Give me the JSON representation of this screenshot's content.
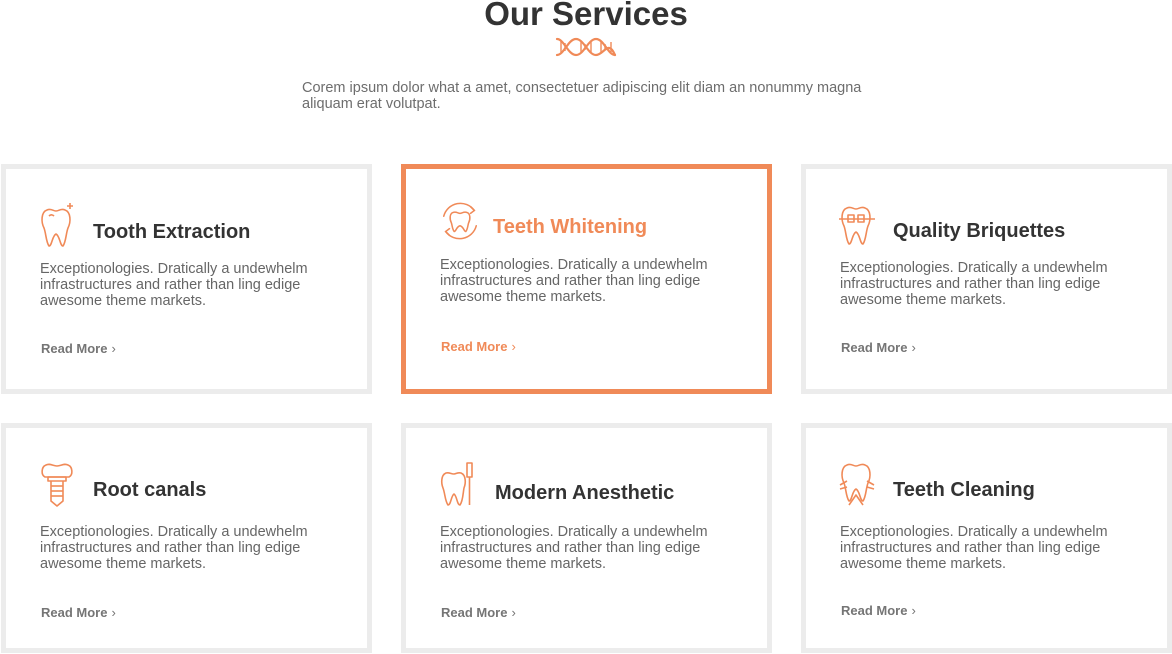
{
  "header": {
    "title": "Our Services",
    "intro": "Corem ipsum dolor what a amet, consectetuer adipiscing elit diam an nonummy magna aliquam erat volutpat."
  },
  "colors": {
    "accent": "#f08a58",
    "border": "#ececec",
    "title": "#333333",
    "text": "#666666"
  },
  "services": [
    {
      "title": "Tooth Extraction",
      "icon": "tooth-sparkle-icon",
      "description": "Exceptionologies. Dratically a undewhelm infrastructures and rather than ling edige awesome theme markets.",
      "link": "Read More",
      "link_arrow": "›"
    },
    {
      "title": "Teeth Whitening",
      "icon": "tooth-whitening-icon",
      "description": "Exceptionologies. Dratically a undewhelm infrastructures and rather than ling edige awesome theme markets.",
      "link": "Read More",
      "link_arrow": "›"
    },
    {
      "title": "Quality Briquettes",
      "icon": "tooth-braces-icon",
      "description": "Exceptionologies. Dratically a undewhelm infrastructures and rather than ling edige awesome theme markets.",
      "link": "Read More",
      "link_arrow": "›"
    },
    {
      "title": "Root canals",
      "icon": "dental-implant-icon",
      "description": "Exceptionologies. Dratically a undewhelm infrastructures and rather than ling edige awesome theme markets.",
      "link": "Read More",
      "link_arrow": "›"
    },
    {
      "title": "Modern Anesthetic",
      "icon": "tooth-toothbrush-icon",
      "description": "Exceptionologies. Dratically a undewhelm infrastructures and rather than ling edige awesome theme markets.",
      "link": "Read More",
      "link_arrow": "›"
    },
    {
      "title": "Teeth Cleaning",
      "icon": "tooth-cleaning-icon",
      "description": "Exceptionologies. Dratically a undewhelm infrastructures and rather than ling edige awesome theme markets.",
      "link": "Read More",
      "link_arrow": "›"
    }
  ]
}
